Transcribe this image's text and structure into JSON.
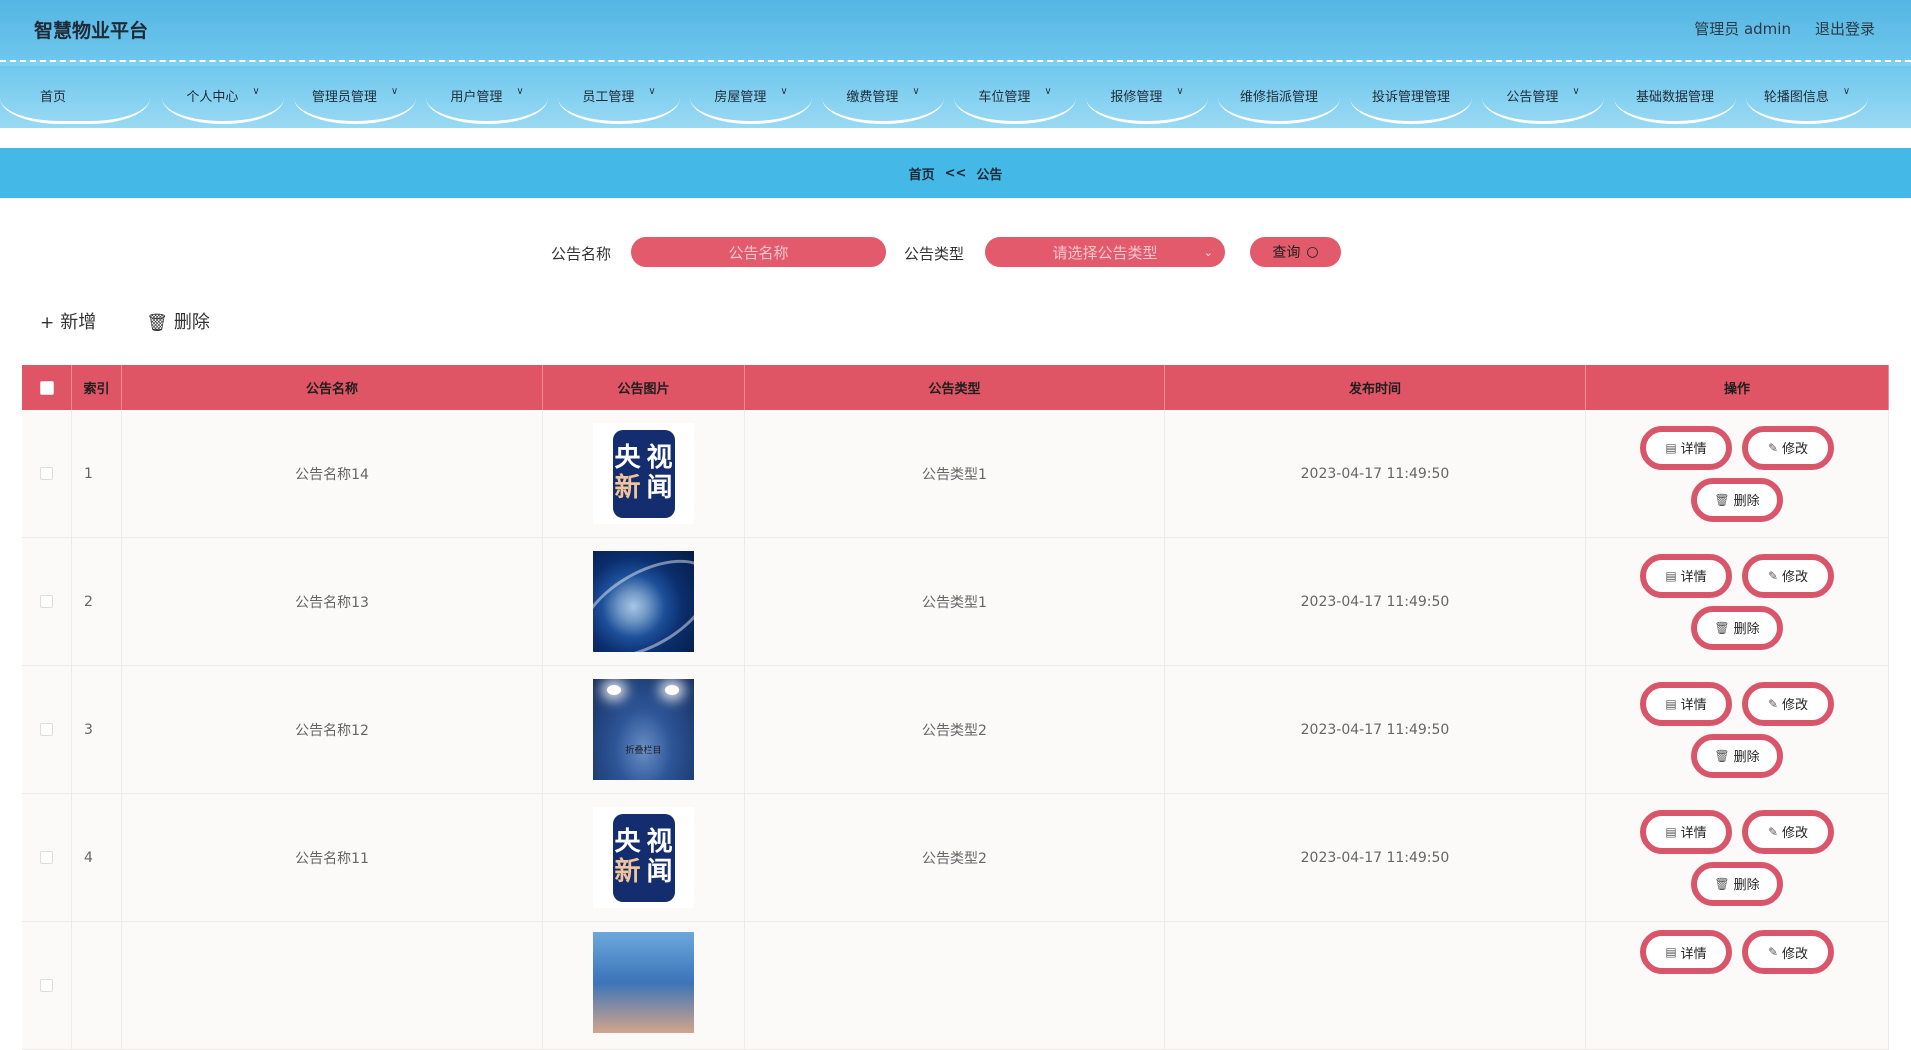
{
  "header": {
    "brand": "智慧物业平台",
    "user": "管理员 admin",
    "logout": "退出登录"
  },
  "nav": [
    {
      "label": "首页",
      "has_menu": false
    },
    {
      "label": "个人中心",
      "has_menu": true
    },
    {
      "label": "管理员管理",
      "has_menu": true
    },
    {
      "label": "用户管理",
      "has_menu": true
    },
    {
      "label": "员工管理",
      "has_menu": true
    },
    {
      "label": "房屋管理",
      "has_menu": true
    },
    {
      "label": "缴费管理",
      "has_menu": true
    },
    {
      "label": "车位管理",
      "has_menu": true
    },
    {
      "label": "报修管理",
      "has_menu": true
    },
    {
      "label": "维修指派管理",
      "has_menu": false
    },
    {
      "label": "投诉管理管理",
      "has_menu": false
    },
    {
      "label": "公告管理",
      "has_menu": true
    },
    {
      "label": "基础数据管理",
      "has_menu": false
    },
    {
      "label": "轮播图信息",
      "has_menu": true
    }
  ],
  "breadcrumb": {
    "home": "首页",
    "sep": "<<",
    "current": "公告"
  },
  "search": {
    "name_label": "公告名称",
    "name_placeholder": "公告名称",
    "type_label": "公告类型",
    "type_placeholder": "请选择公告类型",
    "query_label": "查询"
  },
  "actions": {
    "add": "新增",
    "delete": "删除"
  },
  "table": {
    "headers": [
      "索引",
      "公告名称",
      "公告图片",
      "公告类型",
      "发布时间",
      "操作"
    ],
    "rows": [
      {
        "index": "1",
        "name": "公告名称14",
        "image": "cctv-news-logo",
        "type": "公告类型1",
        "time": "2023-04-17 11:49:50"
      },
      {
        "index": "2",
        "name": "公告名称13",
        "image": "globe-news-image",
        "type": "公告类型1",
        "time": "2023-04-17 11:49:50"
      },
      {
        "index": "3",
        "name": "公告名称12",
        "image": "stage-spotlight-image",
        "type": "公告类型2",
        "time": "2023-04-17 11:49:50"
      },
      {
        "index": "4",
        "name": "公告名称11",
        "image": "cctv-news-logo",
        "type": "公告类型2",
        "time": "2023-04-17 11:49:50"
      },
      {
        "index": "",
        "name": "",
        "image": "partial-image",
        "type": "",
        "time": ""
      }
    ],
    "op_labels": {
      "detail": "详情",
      "edit": "修改",
      "delete": "删除"
    },
    "logo_chars": [
      "央",
      "视",
      "新",
      "闻"
    ],
    "stage_caption": "折叠栏目"
  },
  "colors": {
    "header": "#54b6e3",
    "crumb": "#44b9e8",
    "accent": "#e05565"
  }
}
